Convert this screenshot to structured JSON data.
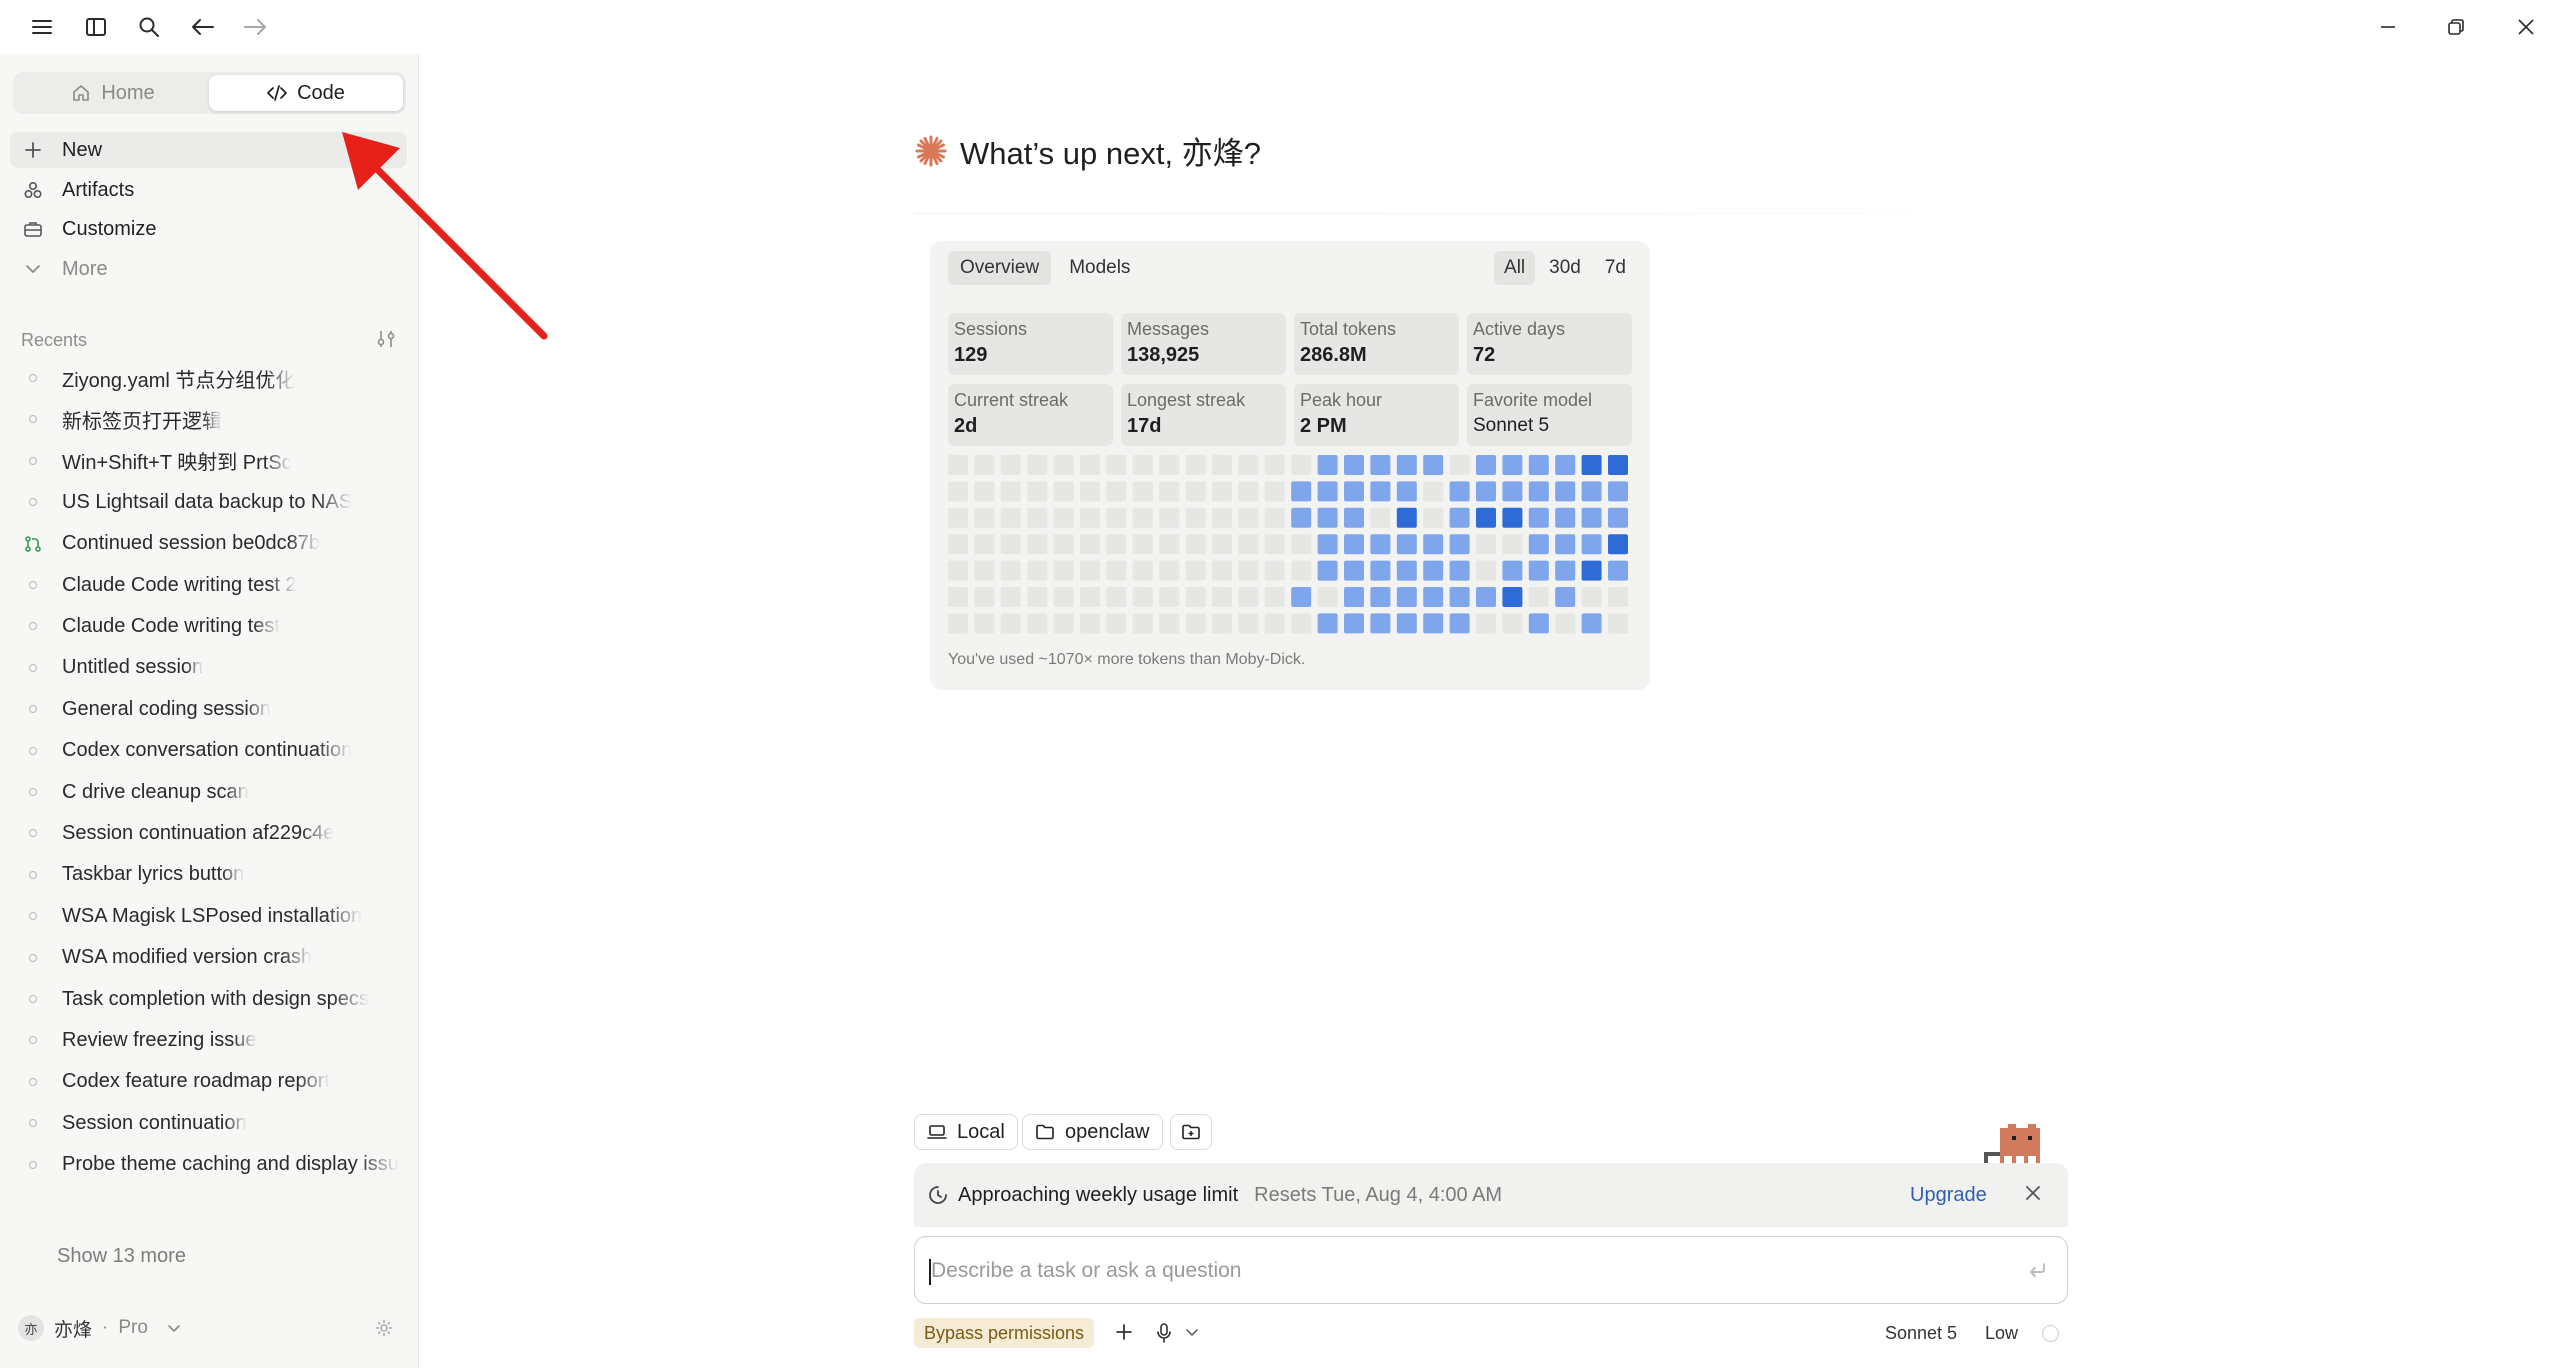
{
  "titlebar": {
    "icons": [
      "menu-icon",
      "sidebar-toggle-icon",
      "search-icon",
      "back-arrow-icon",
      "forward-arrow-icon"
    ],
    "window_controls": [
      "minimize-icon",
      "restore-icon",
      "close-icon"
    ]
  },
  "sidebar": {
    "segments": [
      {
        "label": "Home",
        "icon": "home-icon",
        "active": false
      },
      {
        "label": "Code",
        "icon": "code-icon",
        "active": true
      }
    ],
    "nav": [
      {
        "label": "New",
        "icon": "plus-icon"
      },
      {
        "label": "Artifacts",
        "icon": "artifacts-icon"
      },
      {
        "label": "Customize",
        "icon": "briefcase-icon"
      },
      {
        "label": "More",
        "icon": "chevron-down-icon"
      }
    ],
    "recents_label": "Recents",
    "recents": [
      "Ziyong.yaml 节点分组优化",
      "新标签页打开逻辑",
      "Win+Shift+T 映射到 PrtSc",
      "US Lightsail data backup to NAS",
      "Continued session be0dc87b",
      "Claude Code writing test 2",
      "Claude Code writing test",
      "Untitled session",
      "General coding session",
      "Codex conversation continuation",
      "C drive cleanup scan",
      "Session continuation af229c4e",
      "Taskbar lyrics button",
      "WSA Magisk LSPosed installation",
      "WSA modified version crash",
      "Task completion with design specs",
      "Review freezing issue",
      "Codex feature roadmap report",
      "Session continuation",
      "Probe theme caching and display issu"
    ],
    "show_more": "Show 13 more",
    "user": {
      "avatar": "亦",
      "name": "亦烽",
      "separator": "·",
      "plan": "Pro"
    }
  },
  "main": {
    "greeting": "What’s up next, 亦烽?",
    "stats": {
      "tabs": [
        "Overview",
        "Models"
      ],
      "ranges": [
        "All",
        "30d",
        "7d"
      ],
      "cards": [
        {
          "label": "Sessions",
          "value": "129"
        },
        {
          "label": "Messages",
          "value": "138,925"
        },
        {
          "label": "Total tokens",
          "value": "286.8M"
        },
        {
          "label": "Active days",
          "value": "72"
        },
        {
          "label": "Current streak",
          "value": "2d"
        },
        {
          "label": "Longest streak",
          "value": "17d"
        },
        {
          "label": "Peak hour",
          "value": "2 PM"
        },
        {
          "label": "Favorite model",
          "value": "Sonnet 5"
        }
      ],
      "heatmap": [
        "000000000000001111101111221",
        "000000000000011111011111110",
        "000000000000011102012211110",
        "000000000000001111110011120",
        "000000000000001111110111210",
        "000000000000010111111201000",
        "000000000000001111110010100"
      ],
      "note": "You've used ~1070× more tokens than Moby-Dick."
    }
  },
  "composer": {
    "env_label": "Local",
    "folder_label": "openclaw",
    "banner": {
      "title": "Approaching weekly usage limit",
      "reset": "Resets Tue, Aug 4, 4:00 AM",
      "upgrade": "Upgrade"
    },
    "placeholder": "Describe a task or ask a question",
    "permission_label": "Bypass permissions",
    "model": "Sonnet 5",
    "effort": "Low"
  },
  "colors": {
    "accent": "#d97757",
    "heat_light": "#7fa6ec",
    "heat_dark": "#2f6bd6",
    "heat_empty": "#e6e6e4",
    "upgrade_link": "#2e5fb8",
    "annotation_arrow": "#e8201a"
  }
}
